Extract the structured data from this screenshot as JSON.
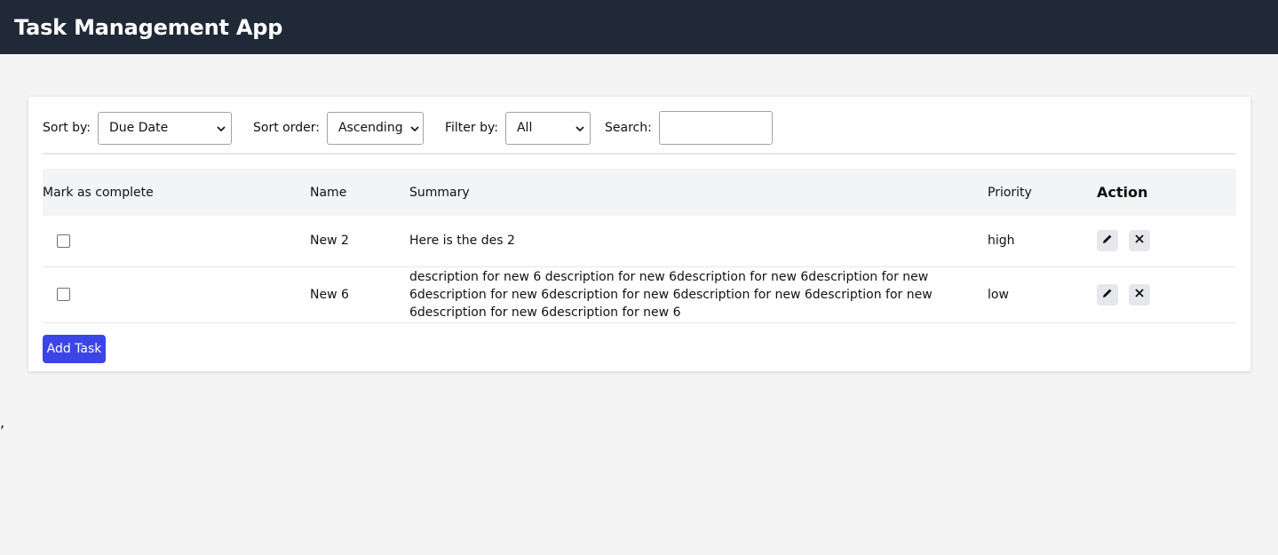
{
  "header": {
    "title": "Task Management App"
  },
  "controls": {
    "sort_by_label": "Sort by:",
    "sort_by_value": "Due Date",
    "sort_order_label": "Sort order:",
    "sort_order_value": "Ascending",
    "filter_label": "Filter by:",
    "filter_value": "All",
    "search_label": "Search:",
    "search_value": ""
  },
  "table": {
    "headers": {
      "complete": "Mark as complete",
      "name": "Name",
      "summary": "Summary",
      "priority": "Priority",
      "action": "Action"
    },
    "rows": [
      {
        "completed": false,
        "name": "New 2",
        "summary": "Here is the des 2",
        "priority": "high"
      },
      {
        "completed": false,
        "name": "New 6",
        "summary": "description for new 6 description for new 6description for new 6description for new 6description for new 6description for new 6description for new 6description for new 6description for new 6description for new 6",
        "priority": "low"
      }
    ]
  },
  "add_task_label": "Add Task",
  "stray_text": ",",
  "icons": {
    "edit": "pencil-icon",
    "delete": "close-icon"
  },
  "colors": {
    "header_bg": "#1f2937",
    "primary": "#3b45e6"
  }
}
